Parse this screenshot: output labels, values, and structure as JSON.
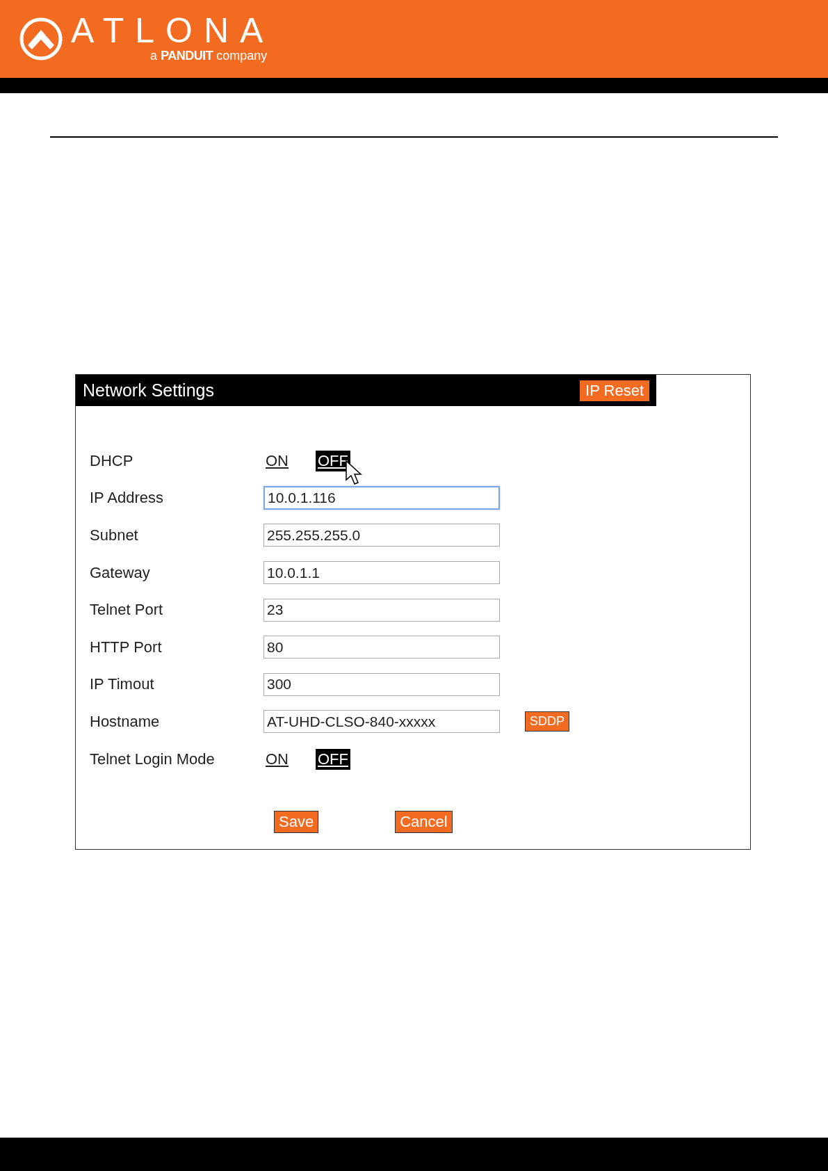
{
  "header": {
    "brand": "ATLONA",
    "tagline": "a **PANDUIT** company"
  },
  "panel": {
    "title": "Network Settings",
    "reset_button": "IP Reset",
    "rows": [
      {
        "kind": "toggle",
        "label": "DHCP",
        "options": [
          {
            "label": "ON",
            "selected": false
          },
          {
            "label": "OFF",
            "selected": true
          }
        ],
        "cursor": true
      },
      {
        "kind": "field",
        "label": "IP Address",
        "value": "10.0.1.116",
        "focused": true
      },
      {
        "kind": "field",
        "label": "Subnet",
        "value": "255.255.255.0",
        "focused": false
      },
      {
        "kind": "field",
        "label": "Gateway",
        "value": "10.0.1.1",
        "focused": false
      },
      {
        "kind": "field",
        "label": "Telnet Port",
        "value": "23",
        "focused": false
      },
      {
        "kind": "field",
        "label": "HTTP Port",
        "value": "80",
        "focused": false
      },
      {
        "kind": "field",
        "label": "IP Timout",
        "value": "300",
        "focused": false
      },
      {
        "kind": "field",
        "label": "Hostname",
        "value": "AT-UHD-CLSO-840-xxxxx",
        "focused": false,
        "button": "SDDP"
      },
      {
        "kind": "toggle",
        "label": "Telnet Login Mode",
        "options": [
          {
            "label": "ON",
            "selected": false
          },
          {
            "label": "OFF",
            "selected": true
          }
        ],
        "cursor": false
      }
    ],
    "buttons": [
      "Save",
      "Cancel"
    ]
  }
}
